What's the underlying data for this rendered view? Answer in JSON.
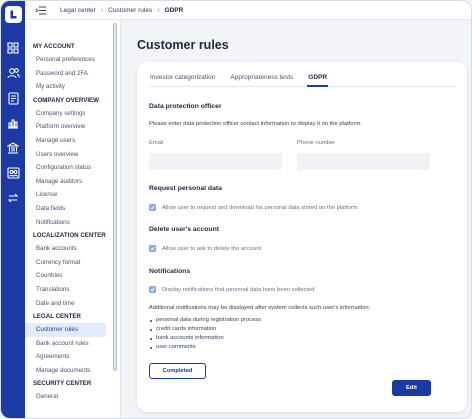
{
  "app": {
    "logo_icon": "brand-logo-icon",
    "rail_icons": [
      "grid-icon",
      "users-icon",
      "document-icon",
      "chart-icon",
      "bank-icon",
      "group-icon",
      "transfer-icon"
    ],
    "brand_color": "#1b3aa3"
  },
  "breadcrumb": {
    "menu_icon": "menu-toggle-icon",
    "items": [
      "Legal center",
      "Customer rules",
      "GDPR"
    ]
  },
  "nav": {
    "sections": [
      {
        "title": "MY ACCOUNT",
        "items": [
          "Personal preferences",
          "Password and 2FA",
          "My activity"
        ]
      },
      {
        "title": "COMPANY OVERVIEW",
        "items": [
          "Company settings",
          "Platform overview",
          "Manage users",
          "Users overview",
          "Configuration status",
          "Manage auditors",
          "License",
          "Data fields",
          "Notifications"
        ]
      },
      {
        "title": "LOCALIZATION CENTER",
        "items": [
          "Bank accounts",
          "Currency format",
          "Countries",
          "Translations",
          "Date and time"
        ]
      },
      {
        "title": "LEGAL CENTER",
        "items": [
          "Customer rules",
          "Bank account rules",
          "Agreements",
          "Manage documents"
        ]
      },
      {
        "title": "SECURITY CENTER",
        "items": [
          "General"
        ]
      }
    ],
    "active_item": "Customer rules"
  },
  "main": {
    "title": "Customer rules",
    "tabs": [
      "Investor categorization",
      "Appropriateness tests",
      "GDPR"
    ],
    "active_tab": "GDPR",
    "dpo": {
      "title": "Data protection officer",
      "description": "Please enter data protection officer contact information to display it on the platform.",
      "email_label": "Email",
      "email_value": "",
      "phone_label": "Phone number",
      "phone_value": ""
    },
    "request": {
      "title": "Request personal data",
      "checkbox_label": "Allow user to request and download his personal data stored on the platform",
      "checked": true
    },
    "delete": {
      "title": "Delete user's account",
      "checkbox_label": "Allow user to ask to delete the account",
      "checked": true
    },
    "notifications": {
      "title": "Notifications",
      "checkbox_label": "Display notifications that personal data have been collected",
      "checked": true,
      "additional_text": "Additional notifications may be displayed after system collects such user's information:",
      "items": [
        "personal data during registration process",
        "credit cards information",
        "bank accounts information",
        "user comments"
      ]
    },
    "completed_label": "Completed",
    "edit_label": "Edit"
  }
}
